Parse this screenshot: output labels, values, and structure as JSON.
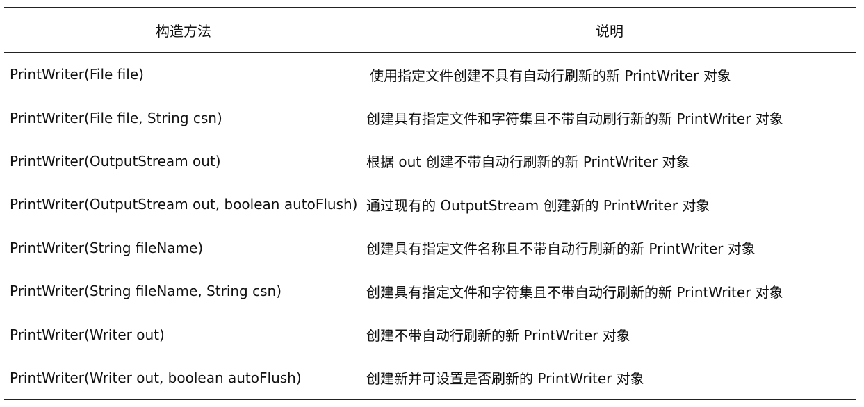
{
  "table": {
    "headers": [
      "构造方法",
      "说明"
    ],
    "rows": [
      {
        "method": "PrintWriter(File file)",
        "desc": "使用指定文件创建不具有自动行刷新的新 PrintWriter 对象"
      },
      {
        "method": "PrintWriter(File file, String csn)",
        "desc": "创建具有指定文件和字符集且不带自动刷行新的新 PrintWriter 对象"
      },
      {
        "method": "PrintWriter(OutputStream out)",
        "desc": "根据 out 创建不带自动行刷新的新 PrintWriter 对象"
      },
      {
        "method": "PrintWriter(OutputStream out, boolean autoFlush)",
        "desc": "通过现有的 OutputStream 创建新的  PrintWriter 对象"
      },
      {
        "method": "PrintWriter(String fileName)",
        "desc": "创建具有指定文件名称且不带自动行刷新的新 PrintWriter 对象"
      },
      {
        "method": "PrintWriter(String fileName, String csn)",
        "desc": "创建具有指定文件和字符集且不带自动行刷新的新 PrintWriter 对象"
      },
      {
        "method": "PrintWriter(Writer out)",
        "desc": "创建不带自动行刷新的新  PrintWriter 对象"
      },
      {
        "method": "PrintWriter(Writer out, boolean autoFlush)",
        "desc": "创建新并可设置是否刷新的  PrintWriter 对象"
      }
    ]
  }
}
